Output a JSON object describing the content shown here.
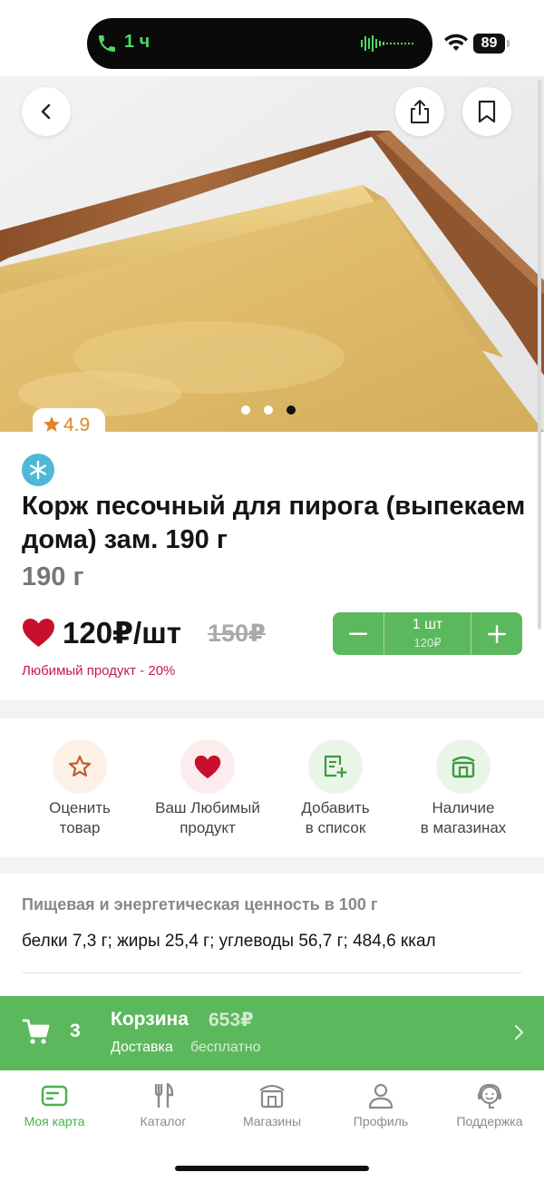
{
  "status_bar": {
    "call_duration": "1 ч",
    "battery_level": "89",
    "icons": [
      "phone-icon",
      "waveform-icon",
      "wifi-icon",
      "battery-icon"
    ]
  },
  "gallery": {
    "image_count": 3,
    "active_index": 2,
    "rating": "4.9"
  },
  "product": {
    "title": "Корж песочный для пирога (выпекаем дома) зам. 190 г",
    "weight": "190 г",
    "price": "120₽/шт",
    "old_price": "150₽",
    "favorite_note": "Любимый продукт - 20%",
    "frozen_badge_icon": "snowflake-icon"
  },
  "stepper": {
    "minus": "–",
    "quantity": "1 шт",
    "subtotal": "120₽",
    "plus": "+"
  },
  "actions": [
    {
      "label_line1": "Оценить",
      "label_line2": "товар",
      "icon": "star-outline-icon"
    },
    {
      "label_line1": "Ваш Любимый",
      "label_line2": "продукт",
      "icon": "heart-icon"
    },
    {
      "label_line1": "Добавить",
      "label_line2": "в список",
      "icon": "add-to-list-icon"
    },
    {
      "label_line1": "Наличие",
      "label_line2": "в магазинах",
      "icon": "store-icon"
    }
  ],
  "nutrition": {
    "title": "Пищевая и энергетическая ценность в 100 г",
    "values": "белки 7,3 г; жиры 25,4 г; углеводы 56,7 г; 484,6 ккал"
  },
  "cart": {
    "count": "3",
    "label": "Корзина",
    "total": "653₽",
    "delivery_label": "Доставка",
    "delivery_value": "бесплатно"
  },
  "tabs": [
    {
      "label": "Моя карта",
      "icon": "card-icon",
      "active": true
    },
    {
      "label": "Каталог",
      "icon": "cutlery-icon",
      "active": false
    },
    {
      "label": "Магазины",
      "icon": "shop-icon",
      "active": false
    },
    {
      "label": "Профиль",
      "icon": "person-icon",
      "active": false
    },
    {
      "label": "Поддержка",
      "icon": "support-icon",
      "active": false
    }
  ],
  "colors": {
    "accent_green": "#5cb85c",
    "tab_active": "#4caf50",
    "heart_red": "#c8102e",
    "favorite_note": "#c2185b",
    "rating_orange": "#e0842a",
    "frozen_badge": "#4fb8d8"
  }
}
